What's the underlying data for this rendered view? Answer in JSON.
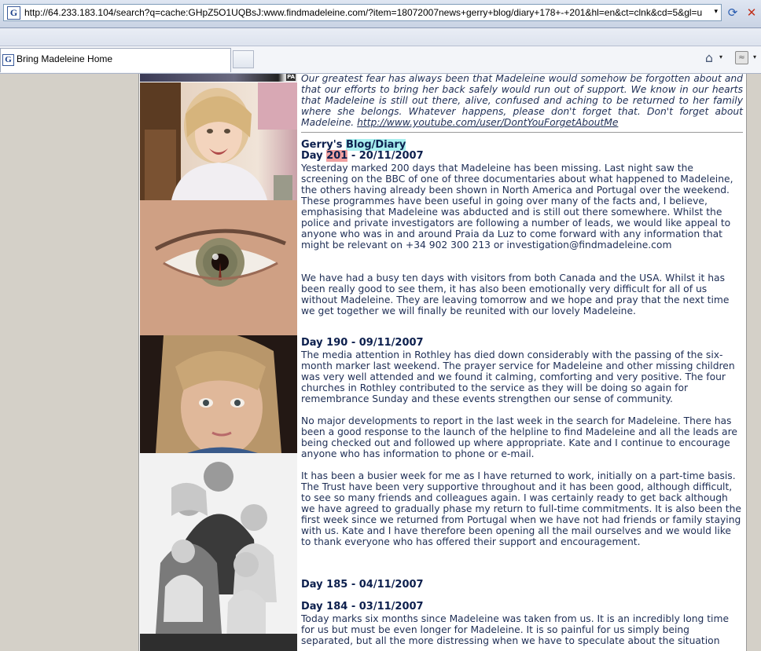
{
  "browser": {
    "address_url": "http://64.233.183.104/search?q=cache:GHpZ5O1UQBsJ:www.findmadeleine.com/?item=18072007news+gerry+blog/diary+178+-+201&hl=en&ct=clnk&cd=5&gl=u",
    "favicon_letter": "G",
    "tab_title": "Bring Madeleine Home"
  },
  "icons": {
    "dropdown": "▾",
    "refresh": "⟳",
    "stop": "✕",
    "home": "⌂",
    "feeds": "≈"
  },
  "photo_pa_label": "PA",
  "intro": {
    "text": "Our greatest fear has always been that Madeleine would somehow be forgotten about and that our efforts to bring her back safely would run out of support. We know in our hearts that Madeleine is still out there, alive, confused and aching to be returned to her family where she belongs. Whatever happens, please don't forget that. Don't forget about Madeleine.",
    "link": "http://www.youtube.com/user/DontYouForgetAboutMe"
  },
  "blog": {
    "title_prefix": "Gerry's",
    "title_highlight": "Blog/Diary",
    "entries": [
      {
        "day_label": "Day",
        "day_number": "201",
        "date": "- 20/11/2007",
        "paragraphs": [
          "Yesterday marked 200 days that Madeleine has been missing. Last night saw the screening on the BBC of one of three documentaries about what happened to Madeleine, the others having already been shown in North America and Portugal over the weekend. These programmes have been useful in going over many of the facts and, I believe, emphasising that Madeleine was abducted and is still out there somewhere. Whilst the police and private investigators are following a number of leads, we would like appeal to anyone who was in and around Praia da Luz to come forward with any information that might be relevant on +34 902 300 213 or investigation@findmadeleine.com",
          "We have had a busy ten days with visitors from both Canada and the USA. Whilst it has been really good to see them, it has also been emotionally very difficult for all of us without Madeleine. They are leaving tomorrow and we hope and pray that the next time we get together we will finally be reunited with our lovely Madeleine."
        ]
      },
      {
        "heading": "Day 190 - 09/11/2007",
        "paragraphs": [
          "The media attention in Rothley has died down considerably with the passing of the six-month marker last weekend. The prayer service for Madeleine and other missing children was very well attended and we found it calming, comforting and very positive. The four churches in Rothley contributed to the service as they will be doing so again for remembrance Sunday and these events strengthen our sense of community.",
          "No major developments to report in the last week in the search for Madeleine. There has been a good response to the launch of the helpline to find Madeleine and all the leads are being checked out and followed up where appropriate. Kate and I continue to encourage anyone who has information to phone or e-mail.",
          "It has been a busier week for me as I have returned to work, initially on a part-time basis. The Trust have been very supportive throughout and it has been good, although difficult, to see so many friends and colleagues again. I was certainly ready to get back although we have agreed to gradually phase my return to full-time commitments. It is also been the first week since we returned from Portugal when we have not had friends or family staying with us. Kate and I have therefore been opening all the mail ourselves and we would like to thank everyone who has offered their support and encouragement."
        ]
      },
      {
        "heading": "Day 185 - 04/11/2007",
        "paragraphs": []
      },
      {
        "heading": "Day 184 - 03/11/2007",
        "paragraphs": [
          "Today marks six months since Madeleine was taken from us. It is an incredibly long time for us but must be even longer for Madeleine. It is so painful for us simply being separated, but all the more distressing when we have to speculate about the situation"
        ]
      }
    ]
  }
}
